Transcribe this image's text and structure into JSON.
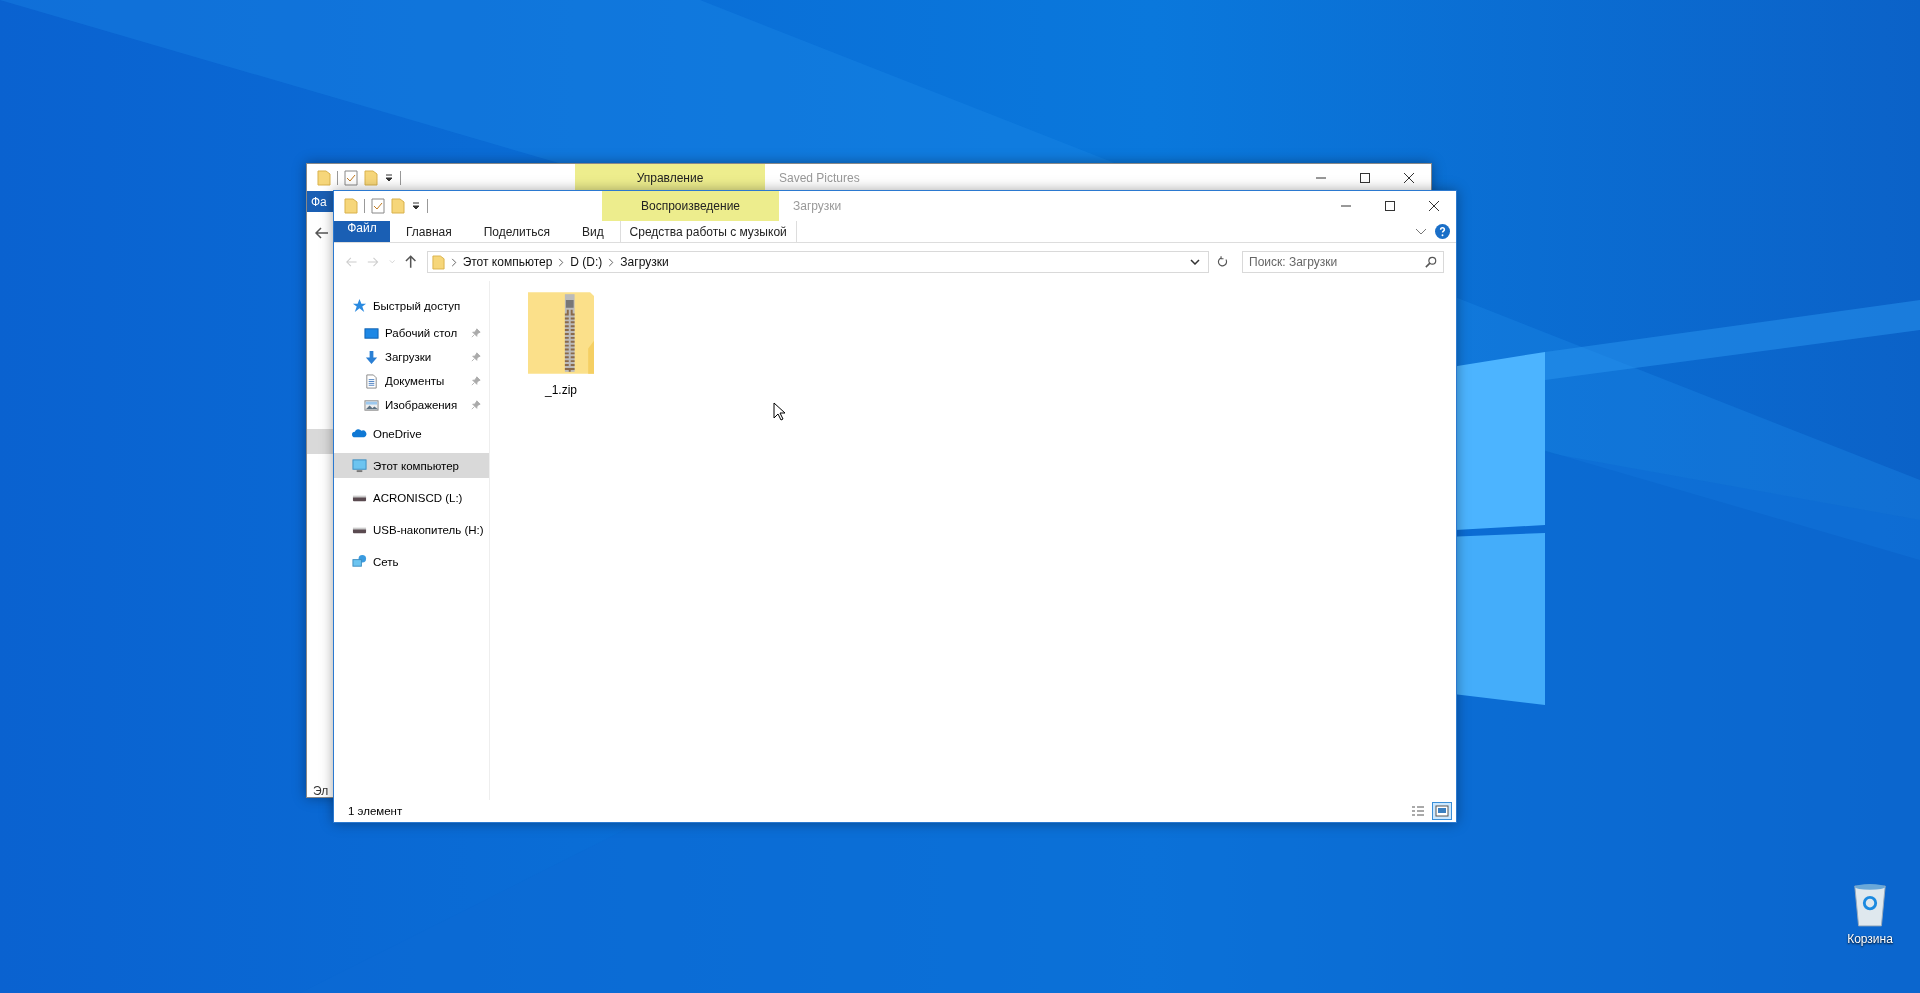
{
  "desktop": {
    "icons": [
      {
        "label": "Корзина",
        "kind": "recycle-bin"
      }
    ]
  },
  "back_window": {
    "contextual_tab": "Управление",
    "title": "Saved Pictures",
    "file_tab": "Фа",
    "status": "Эл"
  },
  "window": {
    "contextual_tab": "Воспроизведение",
    "title": "Загрузки",
    "ribbon_tabs": [
      {
        "label": "Файл",
        "kind": "file"
      },
      {
        "label": "Главная",
        "kind": "plain"
      },
      {
        "label": "Поделиться",
        "kind": "plain"
      },
      {
        "label": "Вид",
        "kind": "plain"
      },
      {
        "label": "Средства работы с музыкой",
        "kind": "contextual"
      }
    ],
    "breadcrumb": [
      "Этот компьютер",
      "D (D:)",
      "Загрузки"
    ],
    "search": {
      "placeholder": "Поиск: Загрузки"
    },
    "nav": [
      {
        "label": "Быстрый доступ",
        "kind": "quick-access",
        "selected": false,
        "children": [
          {
            "label": "Рабочий стол",
            "kind": "desktop",
            "selected": false,
            "pinned": true
          },
          {
            "label": "Загрузки",
            "kind": "downloads",
            "selected": false,
            "pinned": true
          },
          {
            "label": "Документы",
            "kind": "documents",
            "selected": false,
            "pinned": true
          },
          {
            "label": "Изображения",
            "kind": "pictures",
            "selected": false,
            "pinned": true
          }
        ]
      },
      {
        "label": "OneDrive",
        "kind": "onedrive",
        "selected": false
      },
      {
        "label": "Этот компьютер",
        "kind": "computer",
        "selected": true
      },
      {
        "label": "ACRONISCD (L:)",
        "kind": "drive",
        "selected": false
      },
      {
        "label": "USB-накопитель (H:)",
        "kind": "drive",
        "selected": false
      },
      {
        "label": "Сеть",
        "kind": "network",
        "selected": false
      }
    ],
    "files": [
      {
        "name": "_1.zip",
        "kind": "zip"
      }
    ],
    "status_bar": {
      "count": "1 элемент"
    },
    "view_modes": [
      {
        "kind": "details",
        "selected": false
      },
      {
        "kind": "large-icons",
        "selected": true
      }
    ]
  }
}
